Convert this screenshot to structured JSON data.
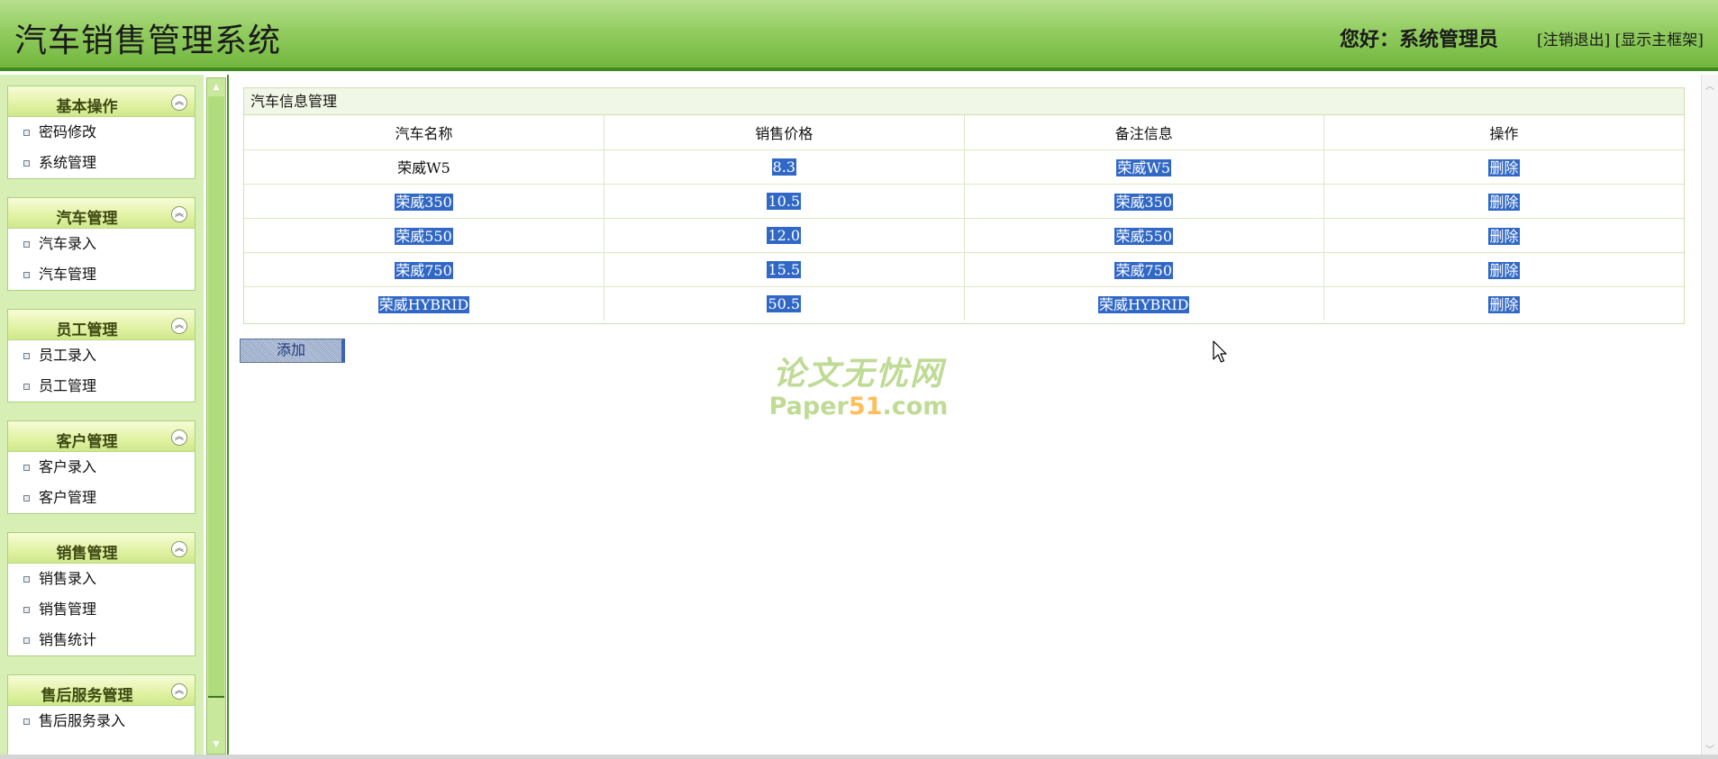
{
  "header": {
    "title": "汽车销售管理系统",
    "greeting": "您好：系统管理员",
    "logout_label": "[注销退出]",
    "show_frame_label": "[显示主框架]"
  },
  "sidebar": {
    "groups": [
      {
        "title": "基本操作",
        "items": [
          "密码修改",
          "系统管理"
        ]
      },
      {
        "title": "汽车管理",
        "items": [
          "汽车录入",
          "汽车管理"
        ]
      },
      {
        "title": "员工管理",
        "items": [
          "员工录入",
          "员工管理"
        ]
      },
      {
        "title": "客户管理",
        "items": [
          "客户录入",
          "客户管理"
        ]
      },
      {
        "title": "销售管理",
        "items": [
          "销售录入",
          "销售管理",
          "销售统计"
        ]
      },
      {
        "title": "售后服务管理",
        "items": [
          "售后服务录入"
        ]
      }
    ]
  },
  "main": {
    "panel_title": "汽车信息管理",
    "columns": [
      "汽车名称",
      "销售价格",
      "备注信息",
      "操作"
    ],
    "rows": [
      {
        "name": "荣威W5",
        "price": "8.3",
        "note": "荣威W5",
        "action": "删除"
      },
      {
        "name": "荣威350",
        "price": "10.5",
        "note": "荣威350",
        "action": "删除"
      },
      {
        "name": "荣威550",
        "price": "12.0",
        "note": "荣威550",
        "action": "删除"
      },
      {
        "name": "荣威750",
        "price": "15.5",
        "note": "荣威750",
        "action": "删除"
      },
      {
        "name": "荣威HYBRID",
        "price": "50.5",
        "note": "荣威HYBRID",
        "action": "删除"
      }
    ],
    "add_label": "添加"
  },
  "watermark": {
    "line1": "论文无忧网",
    "line2_prefix": "Paper",
    "line2_accent": "51",
    "line2_suffix": ".com"
  },
  "colors": {
    "header_green": "#93cd61",
    "selection_blue": "#3168c6",
    "sidebar_bg": "#d7efb4"
  }
}
